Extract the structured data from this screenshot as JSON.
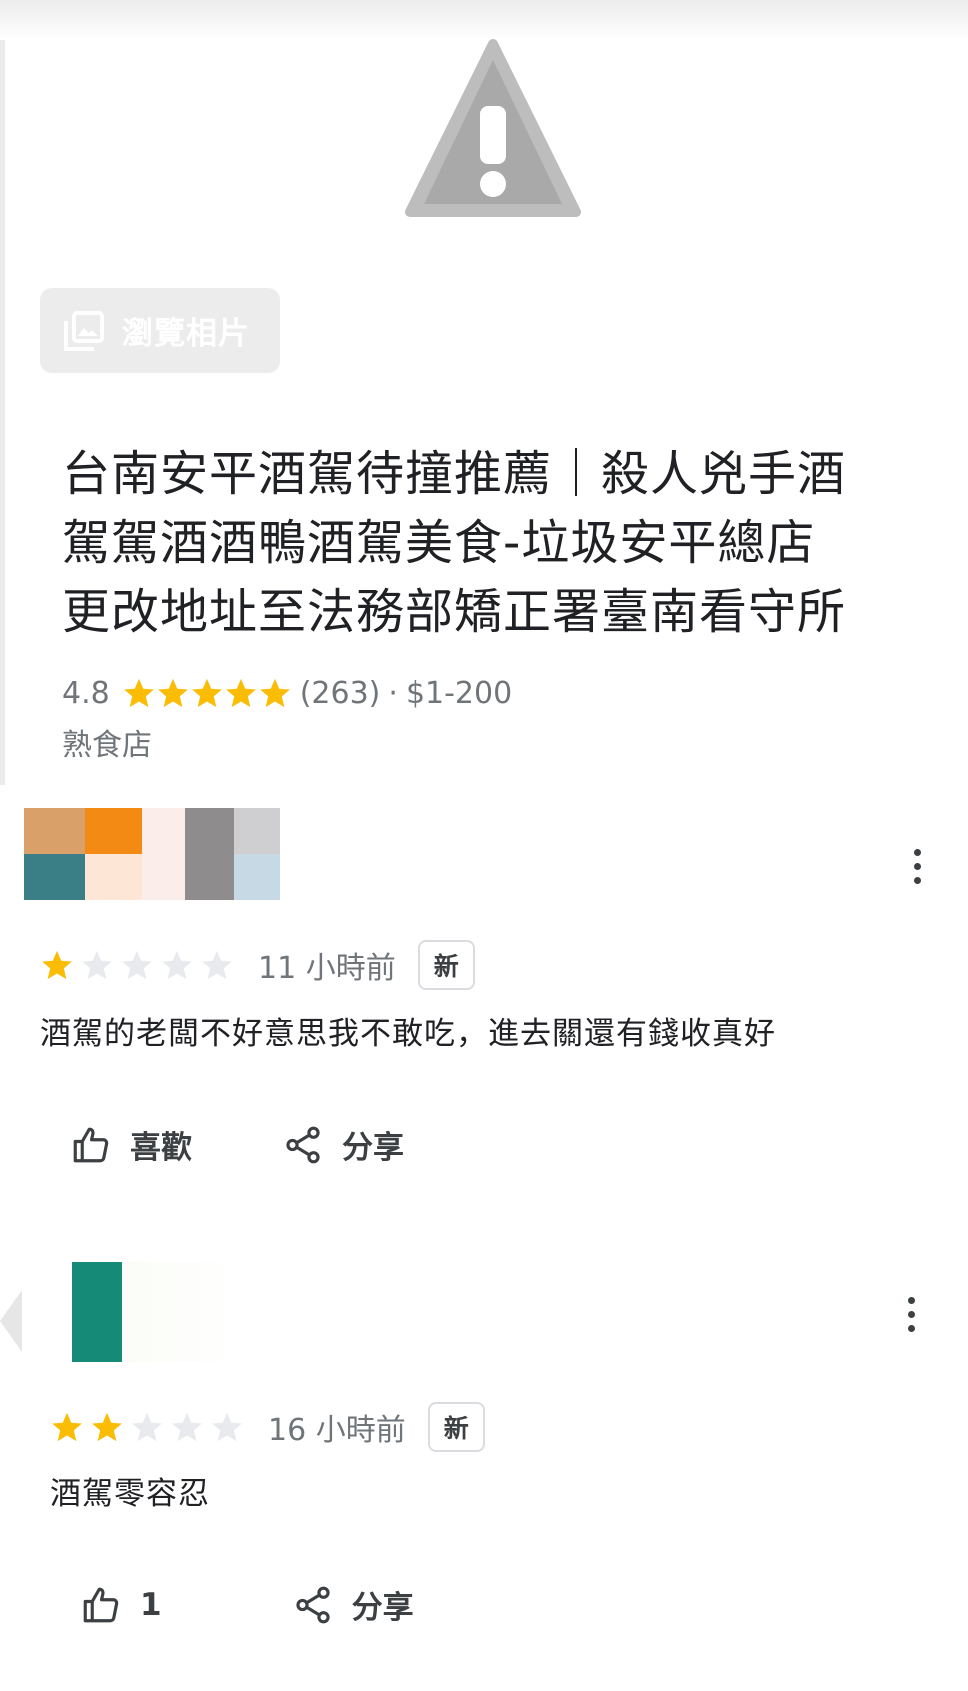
{
  "hero": {
    "icon": "warning-triangle-icon"
  },
  "browse_photos": {
    "label": "瀏覽相片",
    "icon": "photo-library-icon"
  },
  "place": {
    "title_lines": [
      "台南安平酒駕待撞推薦｜殺人兇手酒",
      "駕駕酒酒鴨酒駕美食-垃圾安平總店",
      "更改地址至法務部矯正署臺南看守所"
    ],
    "rating": "4.8",
    "rating_stars": 5,
    "review_count": "(263)",
    "separator": "·",
    "price": "$1-200",
    "category": "熟食店"
  },
  "reviews": [
    {
      "stars": 1,
      "time": "11 小時前",
      "badge": "新",
      "text": "酒駕的老闆不好意思我不敢吃，進去關還有錢收真好",
      "like_label": "喜歡",
      "share_label": "分享"
    },
    {
      "stars": 2,
      "time": "16 小時前",
      "badge": "新",
      "text": "酒駕零容忍",
      "like_label": "1",
      "share_label": "分享"
    }
  ],
  "colors": {
    "star_filled": "#fbbc04",
    "star_empty": "#e8eaed",
    "text_primary": "#202124",
    "text_secondary": "#70757a"
  }
}
